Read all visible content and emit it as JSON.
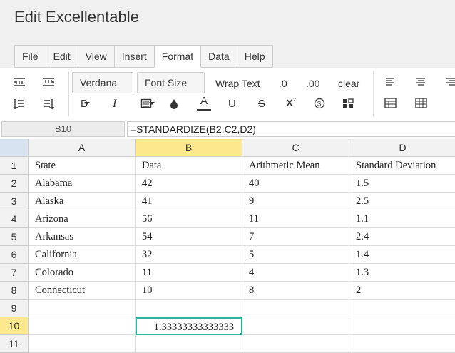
{
  "app": {
    "title": "Edit Excellentable"
  },
  "menu": {
    "tabs": [
      "File",
      "Edit",
      "View",
      "Insert",
      "Format",
      "Data",
      "Help"
    ],
    "active": "Format"
  },
  "toolbar": {
    "font_family": "Verdana",
    "font_size": "Font Size",
    "wrap_text": "Wrap Text",
    "decimal_less": ".0",
    "decimal_more": ".00",
    "clear": "clear",
    "bold": "B",
    "italic": "I",
    "strike": "S",
    "text_color": "A",
    "underline": "U"
  },
  "formula_bar": {
    "cell_ref": "B10",
    "formula": "=STANDARDIZE(B2,C2,D2)"
  },
  "sheet": {
    "columns": [
      "A",
      "B",
      "C",
      "D"
    ],
    "selected_column": "B",
    "rows": [
      "1",
      "2",
      "3",
      "4",
      "5",
      "6",
      "7",
      "8",
      "9",
      "10",
      "11"
    ],
    "selected_row": "10",
    "cells": [
      [
        "State",
        "Data",
        "Arithmetic Mean",
        "Standard Deviation"
      ],
      [
        "Alabama",
        "42",
        "40",
        "1.5"
      ],
      [
        "Alaska",
        "41",
        "9",
        "2.5"
      ],
      [
        "Arizona",
        "56",
        "11",
        "1.1"
      ],
      [
        "Arkansas",
        "54",
        "7",
        "2.4"
      ],
      [
        "California",
        "32",
        "5",
        "1.4"
      ],
      [
        "Colorado",
        "11",
        "4",
        "1.3"
      ],
      [
        "Connecticut",
        "10",
        "8",
        "2"
      ],
      [
        "",
        "",
        "",
        ""
      ],
      [
        "",
        "1.33333333333333",
        "",
        ""
      ],
      [
        "",
        "",
        "",
        ""
      ]
    ]
  },
  "colors": {
    "selection_border": "#2bb59a",
    "header_highlight": "#fce98d",
    "corner": "#d7e3f0"
  }
}
